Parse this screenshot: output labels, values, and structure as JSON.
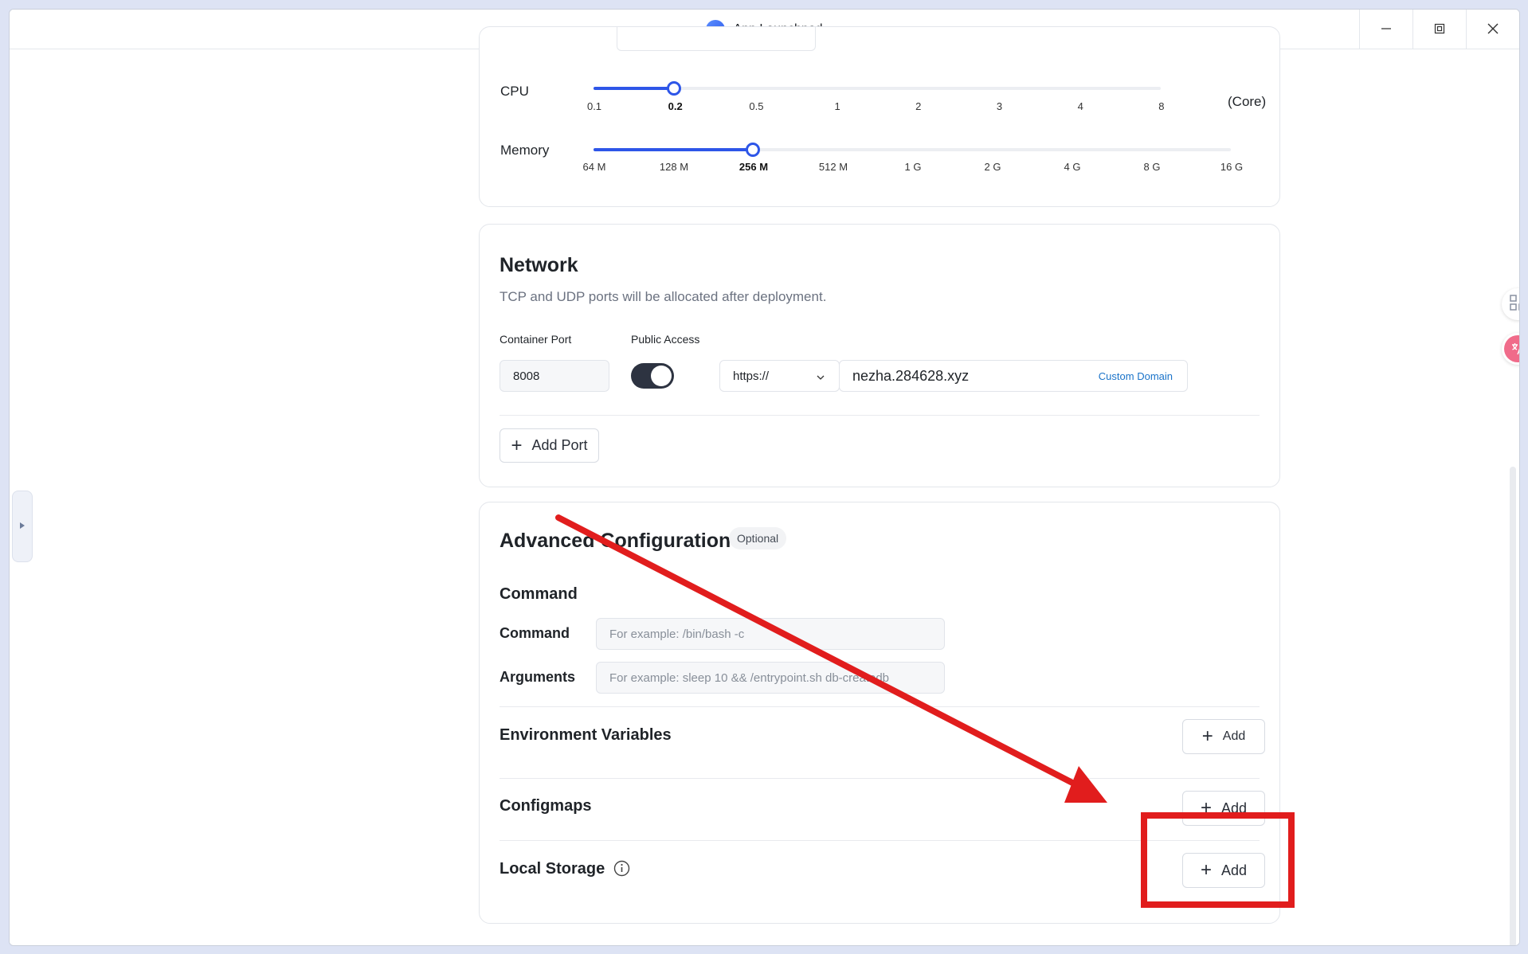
{
  "window": {
    "title": "App Launchpad"
  },
  "resources": {
    "cpu_label": "CPU",
    "cpu_ticks": [
      "0.1",
      "0.2",
      "0.5",
      "1",
      "2",
      "3",
      "4",
      "8"
    ],
    "cpu_selected": "0.2",
    "cpu_unit": "(Core)",
    "memory_label": "Memory",
    "memory_ticks": [
      "64 M",
      "128 M",
      "256 M",
      "512 M",
      "1 G",
      "2 G",
      "4 G",
      "8 G",
      "16 G"
    ],
    "memory_selected": "256 M"
  },
  "network": {
    "title": "Network",
    "description": "TCP and UDP ports will be allocated after deployment.",
    "container_port_label": "Container Port",
    "public_access_label": "Public Access",
    "container_port_value": "8008",
    "public_access_enabled": true,
    "protocol_value": "https://",
    "domain_value": "nezha.284628.xyz",
    "custom_domain_label": "Custom Domain",
    "add_port_label": "Add Port"
  },
  "advanced": {
    "title": "Advanced Configuration",
    "optional_badge": "Optional",
    "command_section_title": "Command",
    "command_label": "Command",
    "command_placeholder": "For example:  /bin/bash -c",
    "arguments_label": "Arguments",
    "arguments_placeholder": "For example:  sleep 10 && /entrypoint.sh db-createdb",
    "env_vars_label": "Environment Variables",
    "configmaps_label": "Configmaps",
    "local_storage_label": "Local Storage",
    "add_label": "Add"
  },
  "colors": {
    "accent": "#2e56e8",
    "annotation_red": "#e11d1d",
    "toggle_on": "#2d3341"
  },
  "icons": [
    "rocket-icon",
    "minimize-icon",
    "restore-icon",
    "close-icon",
    "chevron-down-icon",
    "plus-icon",
    "info-icon",
    "apps-add-icon",
    "translate-icon",
    "caret-right-icon"
  ]
}
